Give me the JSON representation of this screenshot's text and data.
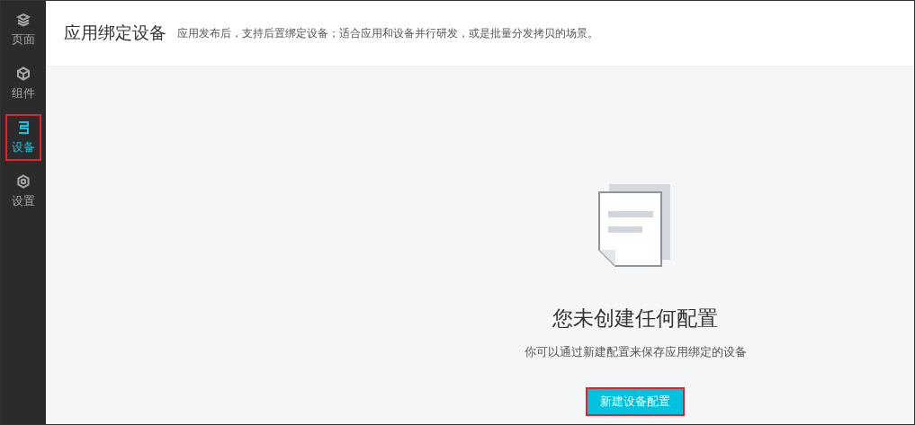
{
  "sidebar": {
    "items": [
      {
        "kind": "layers",
        "label": "页面",
        "selected": false,
        "highlighted": false
      },
      {
        "kind": "cube",
        "label": "组件",
        "selected": false,
        "highlighted": false
      },
      {
        "kind": "device",
        "label": "设备",
        "selected": true,
        "highlighted": true
      },
      {
        "kind": "gear",
        "label": "设置",
        "selected": false,
        "highlighted": false
      }
    ]
  },
  "header": {
    "title": "应用绑定设备",
    "description": "应用发布后，支持后置绑定设备；适合应用和设备并行研发，或是批量分发拷贝的场景。"
  },
  "empty_state": {
    "heading": "您未创建任何配置",
    "message": "你可以通过新建配置来保存应用绑定的设备",
    "button": {
      "label": "新建设备配置",
      "highlighted": true
    }
  }
}
